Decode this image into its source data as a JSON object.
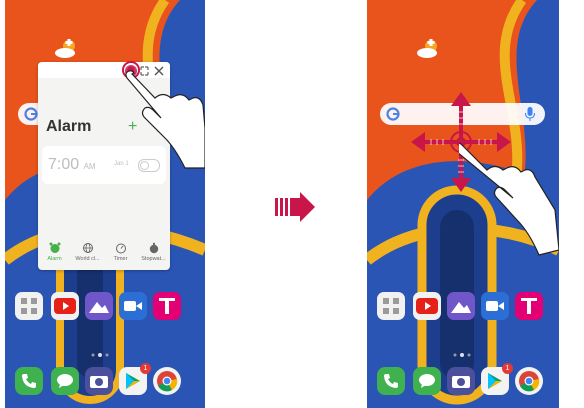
{
  "popup": {
    "title": "Alarm",
    "add_symbol": "+",
    "more_symbol": "⋮",
    "alarm": {
      "time": "7:00",
      "ampm": "AM",
      "date": "Jan 1"
    },
    "tabs": [
      {
        "label": "Alarm",
        "icon": "alarm-clock-icon",
        "active": true
      },
      {
        "label": "World cl...",
        "icon": "globe-icon",
        "active": false
      },
      {
        "label": "Timer",
        "icon": "timer-icon",
        "active": false
      },
      {
        "label": "Stopwat...",
        "icon": "stopwatch-icon",
        "active": false
      }
    ],
    "header_icons": [
      "minimize-icon",
      "maximize-icon",
      "close-icon"
    ]
  },
  "home": {
    "row1_apps": [
      "app-icon",
      "youtube-icon",
      "gallery-icon",
      "video-camera-icon",
      "t-mobile-icon"
    ],
    "dock_apps": [
      "phone-icon",
      "messages-icon",
      "camera-icon",
      "play-store-icon",
      "chrome-icon"
    ],
    "play_store_badge": "1",
    "search_bar": {
      "icons": [
        "google-icon",
        "microphone-icon"
      ]
    }
  },
  "colors": {
    "accent_red": "#c8154a",
    "alarm_green": "#46b04a",
    "wallpaper_orange": "#e8541c",
    "wallpaper_blue": "#2a55b4",
    "wallpaper_yellow": "#f0b21e"
  }
}
